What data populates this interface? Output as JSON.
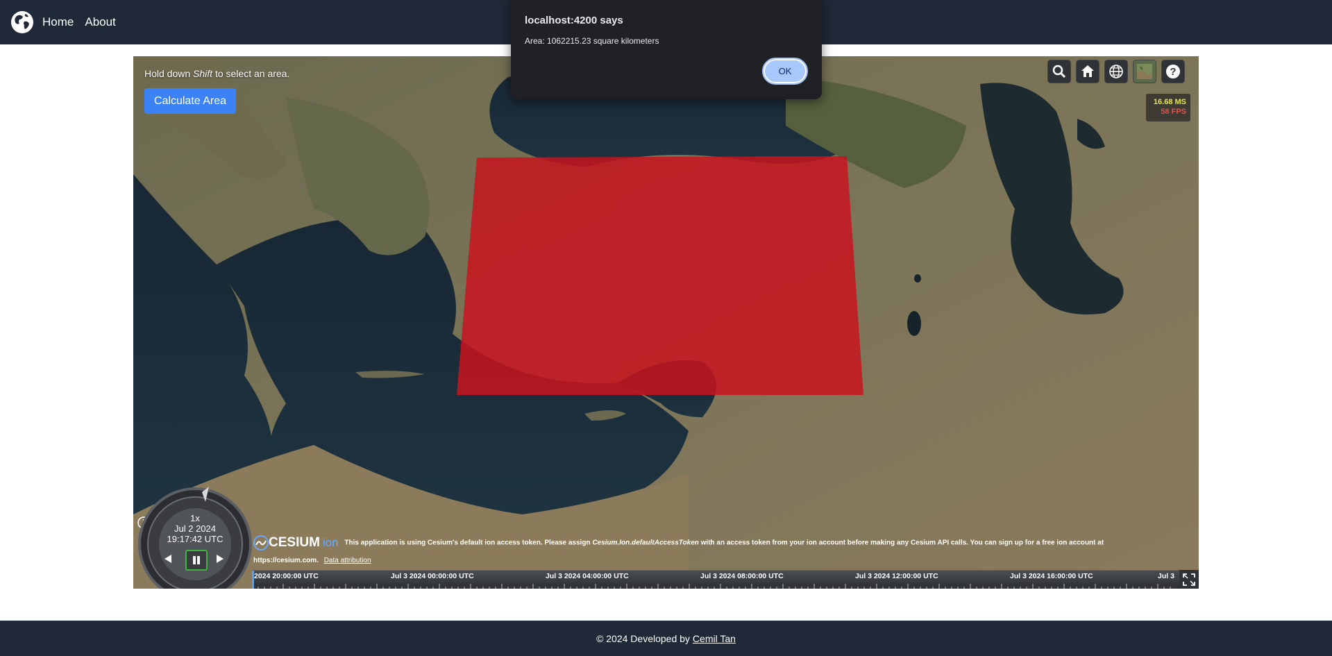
{
  "nav": {
    "logo_icon": "globe-icon",
    "links": [
      {
        "label": "Home"
      },
      {
        "label": "About"
      }
    ]
  },
  "map": {
    "hint_prefix": "Hold down ",
    "hint_key": "Shift",
    "hint_suffix": " to select an area.",
    "calculate_button": "Calculate Area",
    "selection_color": "#c8141e",
    "toolbar": [
      {
        "icon": "search-icon"
      },
      {
        "icon": "home-icon"
      },
      {
        "icon": "globe-icon"
      },
      {
        "icon": "imagery-picker-icon"
      },
      {
        "icon": "help-icon"
      }
    ],
    "performance": {
      "ms": "16.68 MS",
      "fps": "58 FPS"
    },
    "animation": {
      "speed": "1x",
      "date": "Jul 2 2024",
      "time": "19:17:42 UTC"
    },
    "credits": {
      "logo_text": "CESIUM",
      "logo_ion": "ion",
      "message_prefix": "This application is using Cesium's default ion access token. Please assign ",
      "message_code": "Cesium.Ion.defaultAccessToken",
      "message_suffix": " with an access token from your ion account before making any Cesium API calls. You can sign up for a free ion account at",
      "url": "https://cesium.com.",
      "attribution": "Data attribution"
    },
    "timeline_labels": [
      "2024 20:00:00 UTC",
      "Jul 3 2024 00:00:00 UTC",
      "Jul 3 2024 04:00:00 UTC",
      "Jul 3 2024 08:00:00 UTC",
      "Jul 3 2024 12:00:00 UTC",
      "Jul 3 2024 16:00:00 UTC",
      "Jul 3"
    ]
  },
  "dialog": {
    "title": "localhost:4200 says",
    "message": "Area: 1062215.23 square kilometers",
    "ok": "OK"
  },
  "footer": {
    "text": "© 2024 Developed by",
    "author": "Cemil Tan"
  }
}
